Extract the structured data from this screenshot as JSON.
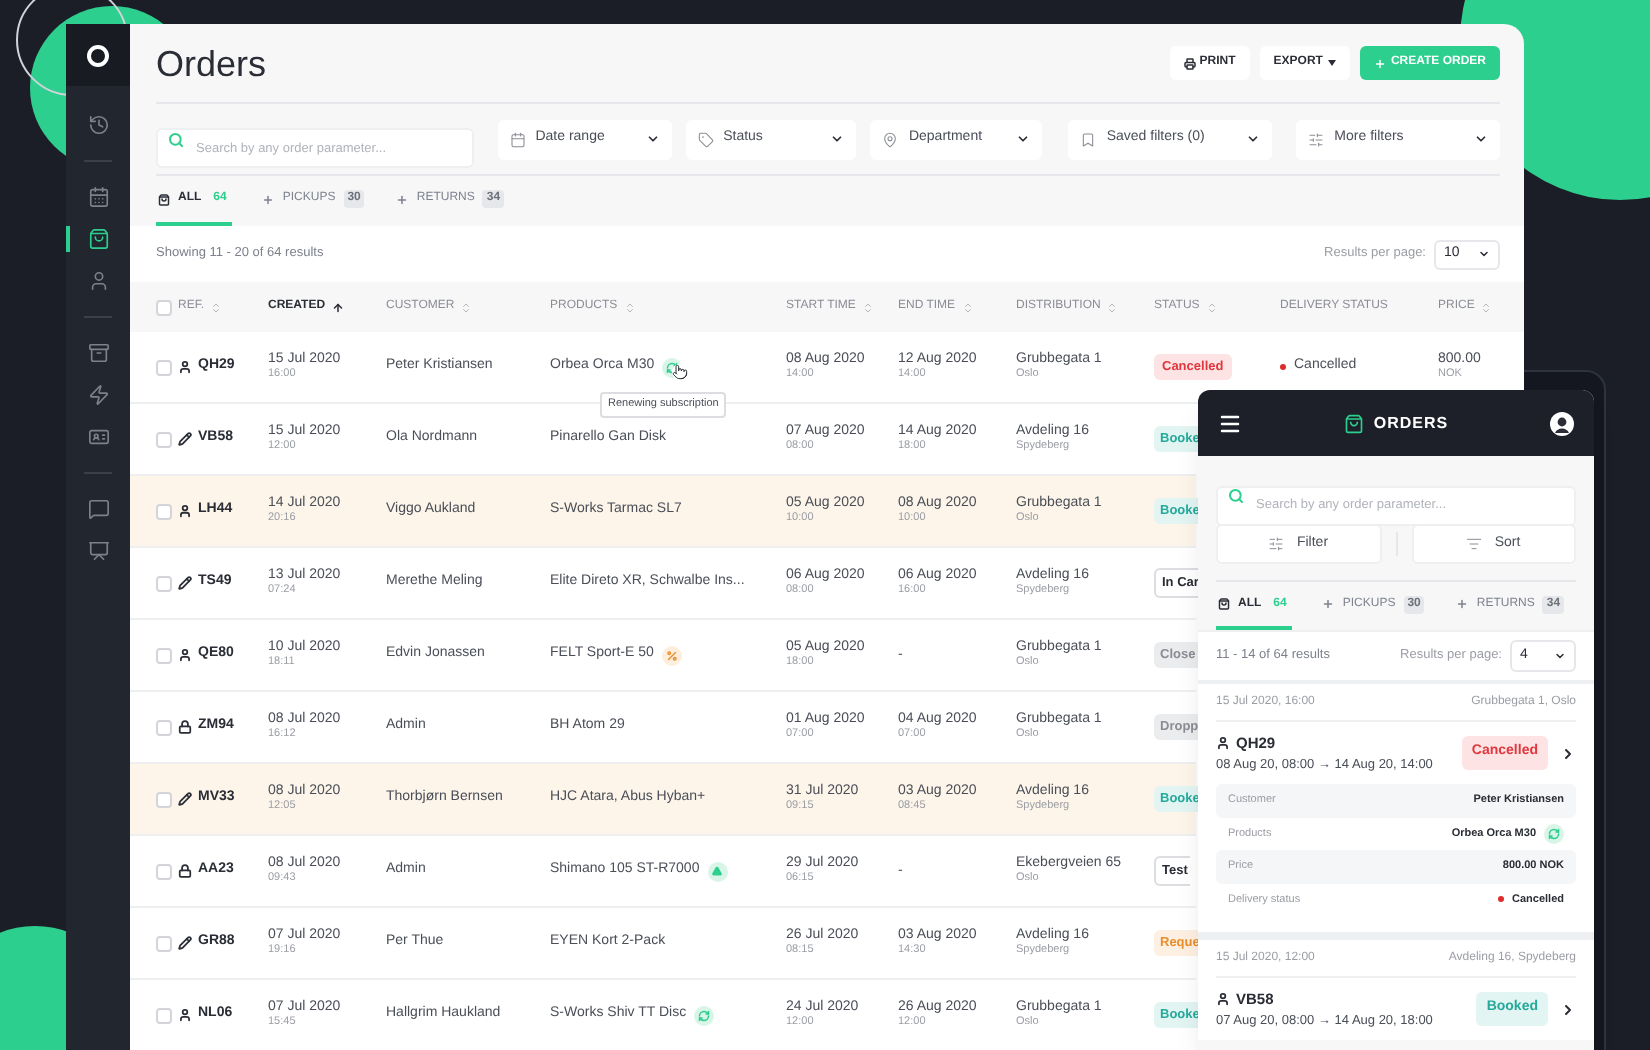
{
  "sidebar": {
    "items": [
      {
        "selected": false
      },
      {
        "selected": false
      },
      {
        "selected": true
      },
      {
        "selected": false
      },
      {
        "selected": false
      },
      {
        "selected": false
      },
      {
        "selected": false
      },
      {
        "selected": false
      },
      {
        "selected": false
      }
    ]
  },
  "header": {
    "title": "Orders",
    "buttons": [
      {
        "label": "PRINT",
        "kind": "print"
      },
      {
        "label": "EXPORT",
        "kind": "menu"
      },
      {
        "label": "CREATE ORDER",
        "kind": "primary"
      }
    ]
  },
  "search": {
    "placeholder": "Search by any order parameter..."
  },
  "filters": [
    {
      "label": "Date range"
    },
    {
      "label": "Status"
    },
    {
      "label": "Department"
    },
    {
      "label": "Saved filters (0)"
    },
    {
      "label": "More filters"
    }
  ],
  "tabs": [
    {
      "label": "ALL",
      "count": "64",
      "selected": true
    },
    {
      "label": "PICKUPS",
      "count": "30",
      "selected": false
    },
    {
      "label": "RETURNS",
      "count": "34",
      "selected": false
    }
  ],
  "results_summary": "Showing 11 - 20 of 64 results",
  "results_per_page": {
    "label": "Results per page:",
    "value": "10"
  },
  "table": {
    "select_all_checked": false,
    "columns": [
      {
        "label": "REF.",
        "sortable": true,
        "sorted": false
      },
      {
        "label": "CREATED",
        "sortable": true,
        "sorted": true
      },
      {
        "label": "CUSTOMER",
        "sortable": true,
        "sorted": false
      },
      {
        "label": "PRODUCTS",
        "sortable": true,
        "sorted": false
      },
      {
        "label": "START TIME",
        "sortable": true,
        "sorted": false
      },
      {
        "label": "END TIME",
        "sortable": true,
        "sorted": false
      },
      {
        "label": "DISTRIBUTION",
        "sortable": true,
        "sorted": false
      },
      {
        "label": "STATUS",
        "sortable": true,
        "sorted": false
      },
      {
        "label": "DELIVERY STATUS",
        "sortable": false,
        "sorted": false
      },
      {
        "label": "PRICE",
        "sortable": true,
        "sorted": false
      }
    ],
    "rows": [
      {
        "checked": false,
        "highlighted": false,
        "ref": {
          "kind": "person",
          "text": "QH29"
        },
        "created_date": "15 Jul 2020",
        "created_time": "16:00",
        "customer": "Peter Kristiansen",
        "product": "Orbea Orca M30",
        "product_badge": {
          "kind": "renew"
        },
        "tooltip": "Renewing subscription",
        "start_date": "08 Aug 2020",
        "start_time": "14:00",
        "end_date": "12 Aug 2020",
        "end_time": "14:00",
        "distribution": "Grubbegata 1",
        "distribution_city": "Oslo",
        "status": {
          "kind": "cancelled",
          "text": "Cancelled"
        },
        "delivery": {
          "text": "Cancelled",
          "color": "#e02b2b"
        },
        "price": "800.00",
        "currency": "NOK"
      },
      {
        "checked": false,
        "highlighted": false,
        "ref": {
          "kind": "pencil",
          "text": "VB58"
        },
        "created_date": "15 Jul 2020",
        "created_time": "12:00",
        "customer": "Ola Nordmann",
        "product": "Pinarello Gan Disk",
        "start_date": "07 Aug 2020",
        "start_time": "08:00",
        "end_date": "14 Aug 2020",
        "end_time": "18:00",
        "distribution": "Avdeling 16",
        "distribution_city": "Spydeberg",
        "status": {
          "kind": "booked",
          "text": "Booke"
        }
      },
      {
        "checked": false,
        "highlighted": true,
        "ref": {
          "kind": "person",
          "text": "LH44"
        },
        "created_date": "14 Jul 2020",
        "created_time": "20:16",
        "customer": "Viggo Aukland",
        "product": "S-Works Tarmac SL7",
        "start_date": "05 Aug 2020",
        "start_time": "10:00",
        "end_date": "08 Aug 2020",
        "end_time": "10:00",
        "distribution": "Grubbegata 1",
        "distribution_city": "Oslo",
        "status": {
          "kind": "booked",
          "text": "Booke"
        }
      },
      {
        "checked": false,
        "highlighted": false,
        "ref": {
          "kind": "pencil",
          "text": "TS49"
        },
        "created_date": "13 Jul 2020",
        "created_time": "07:24",
        "customer": "Merethe Meling",
        "product": "Elite Direto XR, Schwalbe Ins...",
        "start_date": "06 Aug 2020",
        "start_time": "08:00",
        "end_date": "06 Aug 2020",
        "end_time": "16:00",
        "distribution": "Avdeling 16",
        "distribution_city": "Spydeberg",
        "status": {
          "kind": "outlined",
          "text": "In Car"
        }
      },
      {
        "checked": false,
        "highlighted": false,
        "ref": {
          "kind": "person",
          "text": "QE80"
        },
        "created_date": "10 Jul 2020",
        "created_time": "18:11",
        "customer": "Edvin Jonassen",
        "product": "FELT Sport-E 50",
        "product_badge": {
          "kind": "percent"
        },
        "start_date": "05 Aug 2020",
        "start_time": "18:00",
        "end_date": "-",
        "distribution": "Grubbegata 1",
        "distribution_city": "Oslo",
        "status": {
          "kind": "closed",
          "text": "Close"
        }
      },
      {
        "checked": false,
        "highlighted": false,
        "ref": {
          "kind": "lock",
          "text": "ZM94"
        },
        "created_date": "08 Jul 2020",
        "created_time": "16:12",
        "customer": "Admin",
        "product": "BH Atom 29",
        "start_date": "01 Aug 2020",
        "start_time": "07:00",
        "end_date": "04 Aug 2020",
        "end_time": "07:00",
        "distribution": "Grubbegata 1",
        "distribution_city": "Oslo",
        "status": {
          "kind": "closed",
          "text": "Dropp"
        }
      },
      {
        "checked": false,
        "highlighted": true,
        "ref": {
          "kind": "pencil",
          "text": "MV33"
        },
        "created_date": "08 Jul 2020",
        "created_time": "12:05",
        "customer": "Thorbjørn Bernsen",
        "product": "HJC Atara, Abus Hyban+",
        "start_date": "31 Jul 2020",
        "start_time": "09:15",
        "end_date": "03 Aug 2020",
        "end_time": "08:45",
        "distribution": "Avdeling 16",
        "distribution_city": "Spydeberg",
        "status": {
          "kind": "booked",
          "text": "Booke"
        }
      },
      {
        "checked": false,
        "highlighted": false,
        "ref": {
          "kind": "lock",
          "text": "AA23"
        },
        "created_date": "08 Jul 2020",
        "created_time": "09:43",
        "customer": "Admin",
        "product": "Shimano 105 ST-R7000",
        "product_badge": {
          "kind": "triangle"
        },
        "start_date": "29 Jul 2020",
        "start_time": "06:15",
        "end_date": "-",
        "distribution": "Ekebergveien 65",
        "distribution_city": "Oslo",
        "status": {
          "kind": "outlined",
          "text": "Test"
        }
      },
      {
        "checked": false,
        "highlighted": false,
        "ref": {
          "kind": "pencil",
          "text": "GR88"
        },
        "created_date": "07 Jul 2020",
        "created_time": "19:16",
        "customer": "Per Thue",
        "product": "EYEN Kort 2-Pack",
        "start_date": "26 Jul 2020",
        "start_time": "08:15",
        "end_date": "03 Aug 2020",
        "end_time": "14:30",
        "distribution": "Avdeling 16",
        "distribution_city": "Spydeberg",
        "status": {
          "kind": "requested",
          "text": "Reque"
        }
      },
      {
        "checked": false,
        "highlighted": false,
        "ref": {
          "kind": "person",
          "text": "NL06"
        },
        "created_date": "07 Jul 2020",
        "created_time": "15:45",
        "customer": "Hallgrim Haukland",
        "product": "S-Works Shiv TT Disc",
        "product_badge": {
          "kind": "renew"
        },
        "start_date": "24 Jul 2020",
        "start_time": "12:00",
        "end_date": "26 Aug 2020",
        "end_time": "12:00",
        "distribution": "Grubbegata 1",
        "distribution_city": "Oslo",
        "status": {
          "kind": "booked",
          "text": "Booke"
        }
      }
    ]
  },
  "mobile": {
    "title": "ORDERS",
    "search": {
      "placeholder": "Search by any order parameter..."
    },
    "buttons": [
      {
        "label": "Filter"
      },
      {
        "label": "Sort"
      }
    ],
    "tabs": [
      {
        "label": "ALL",
        "count": "64",
        "selected": true
      },
      {
        "label": "PICKUPS",
        "count": "30",
        "selected": false
      },
      {
        "label": "RETURNS",
        "count": "34",
        "selected": false
      }
    ],
    "results_summary": "11 - 14 of 64 results",
    "results_per_page": {
      "label": "Results per page:",
      "value": "4"
    },
    "cards": [
      {
        "date": "15 Jul 2020, 16:00",
        "location": "Grubbegata 1, Oslo",
        "ref": {
          "kind": "person",
          "text": "QH29"
        },
        "period": "08 Aug 20, 08:00 → 14 Aug 20, 14:00",
        "status": {
          "kind": "cancelled",
          "text": "Cancelled"
        },
        "details": [
          {
            "label": "Customer",
            "value": "Peter Kristiansen"
          },
          {
            "label": "Products",
            "value": "Orbea Orca M30",
            "badge": {
              "kind": "renew"
            }
          },
          {
            "label": "Price",
            "value": "800.00 NOK"
          },
          {
            "label": "Delivery status",
            "value": "Cancelled",
            "color": "#e02b2b"
          }
        ]
      },
      {
        "date": "15 Jul 2020, 12:00",
        "location": "Avdeling 16, Spydeberg",
        "ref": {
          "kind": "person",
          "text": "VB58"
        },
        "period": "07 Aug 20, 08:00 → 14 Aug 20, 18:00",
        "status": {
          "kind": "booked",
          "text": "Booked"
        }
      }
    ]
  }
}
